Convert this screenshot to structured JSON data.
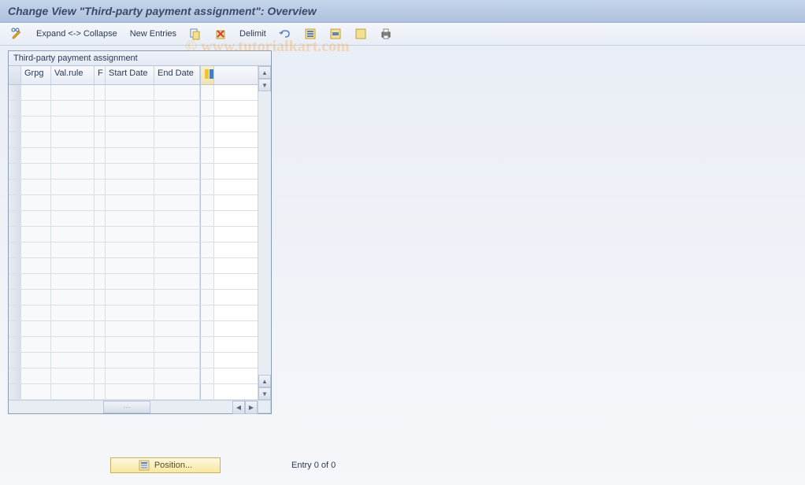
{
  "title": "Change View \"Third-party payment assignment\": Overview",
  "toolbar": {
    "expand_collapse": "Expand <-> Collapse",
    "new_entries": "New Entries",
    "delimit": "Delimit"
  },
  "table": {
    "title": "Third-party payment assignment",
    "columns": {
      "grpg": "Grpg",
      "valrule": "Val.rule",
      "f": "F",
      "startdate": "Start Date",
      "enddate": "End Date"
    },
    "rows": []
  },
  "footer": {
    "position_label": "Position...",
    "entry_status": "Entry 0 of 0"
  },
  "watermark": "© www.tutorialkart.com"
}
